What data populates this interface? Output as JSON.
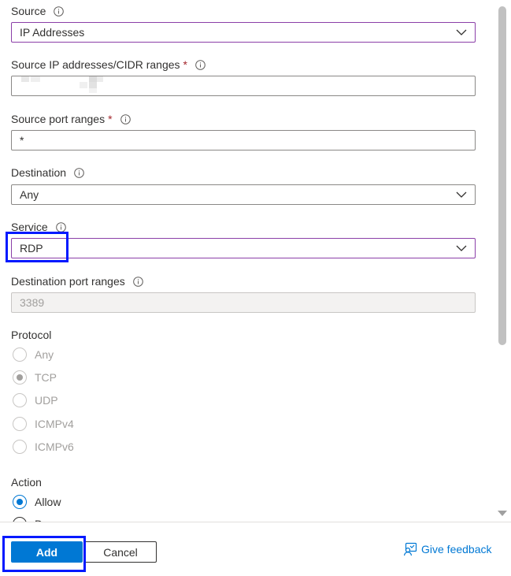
{
  "fields": {
    "source": {
      "label": "Source",
      "value": "IP Addresses"
    },
    "source_ip": {
      "label": "Source IP addresses/CIDR ranges",
      "required": "*",
      "value": ""
    },
    "source_port": {
      "label": "Source port ranges",
      "required": "*",
      "value": "*"
    },
    "destination": {
      "label": "Destination",
      "value": "Any"
    },
    "service": {
      "label": "Service",
      "value": "RDP"
    },
    "dest_port": {
      "label": "Destination port ranges",
      "value": "3389"
    }
  },
  "protocol": {
    "label": "Protocol",
    "options": [
      "Any",
      "TCP",
      "UDP",
      "ICMPv4",
      "ICMPv6"
    ],
    "selected": "TCP"
  },
  "action": {
    "label": "Action",
    "options": [
      "Allow",
      "D"
    ],
    "selected": "Allow"
  },
  "footer": {
    "add_label": "Add",
    "cancel_label": "Cancel",
    "feedback_label": "Give feedback"
  },
  "colors": {
    "accent": "#0078d4",
    "highlight": "#0019ff",
    "required": "#a4262c",
    "select_border": "#8b3fa8"
  },
  "icons": [
    "info-icon",
    "chevron-down-icon",
    "feedback-icon"
  ]
}
